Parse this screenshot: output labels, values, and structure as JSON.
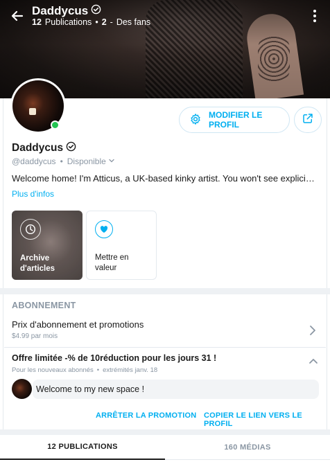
{
  "header": {
    "display_name": "Daddycus",
    "publications_count": "12",
    "publications_label": "Publications",
    "fans_count": "2",
    "fans_label": "Des fans",
    "separator": "•"
  },
  "actions": {
    "edit_profile_label": "MODIFIER LE PROFIL"
  },
  "profile": {
    "name": "Daddycus",
    "handle": "@daddycus",
    "dot": "•",
    "status": "Disponible",
    "bio": "Welcome home! I'm Atticus, a UK-based kinky artist. You won't see explicitly…",
    "more_info": "Plus d'infos"
  },
  "highlights": [
    {
      "label": "Archive d'articles"
    },
    {
      "label": "Mettre en valeur"
    }
  ],
  "subscription": {
    "section_title": "ABONNEMENT",
    "price_title": "Prix d'abonnement et promotions",
    "price_value": "$4.99 par mois",
    "offer_title": "Offre limitée -% de 10réduction pour les jours 31 !",
    "offer_audience": "Pour les nouveaux abonnés",
    "offer_dot": "•",
    "offer_expiry": "extrémités janv. 18",
    "message": "Welcome to my new space !",
    "stop_label": "ARRÊTER LA PROMOTION",
    "copy_label": "COPIER LE LIEN VERS LE PROFIL"
  },
  "tabs": [
    {
      "label": "12 PUBLICATIONS",
      "active": true
    },
    {
      "label": "160 MÉDIAS",
      "active": false
    }
  ],
  "colors": {
    "accent": "#00aff0",
    "online": "#23c552",
    "muted": "#8a96a3"
  }
}
